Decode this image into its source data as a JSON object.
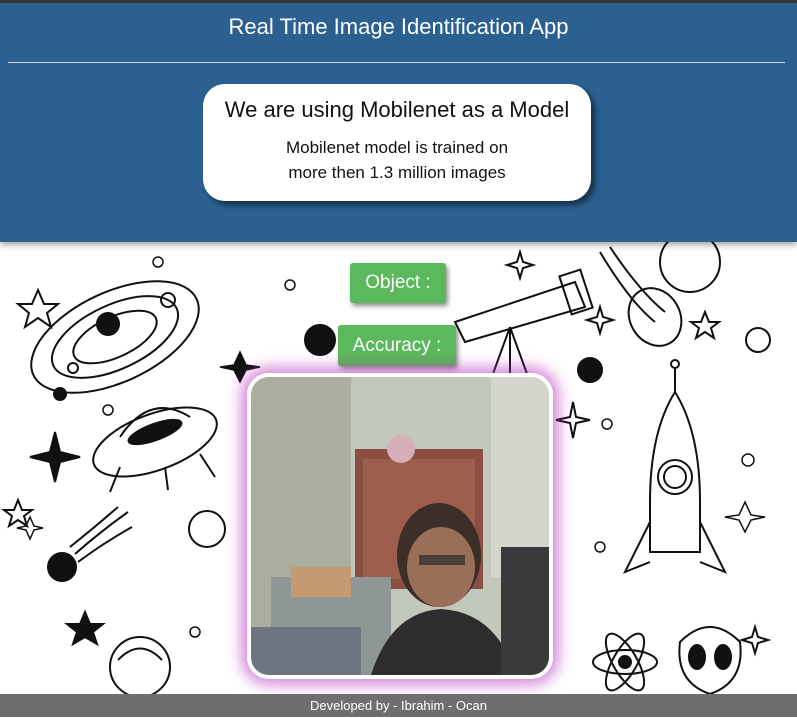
{
  "header": {
    "title": "Real Time Image Identification App"
  },
  "model_card": {
    "heading": "We are using Mobilenet as a Model",
    "line1": "Mobilenet model is trained on",
    "line2": "more then 1.3 million images"
  },
  "results": {
    "object_label": "Object :",
    "accuracy_label": "Accuracy :"
  },
  "footer": {
    "credit": "Developed by - Ibrahim - Ocan"
  },
  "colors": {
    "header_bg": "#2b6090",
    "button_green": "#5cb85c",
    "video_glow": "#b428be",
    "footer_bg": "#6e6e6e"
  },
  "background": {
    "theme": "space-doodles",
    "icons": [
      "star-icon",
      "planet-orbit-icon",
      "ufo-icon",
      "telescope-icon",
      "rocket-icon",
      "comet-icon",
      "sparkle-icon",
      "astronaut-helmet-icon",
      "alien-head-icon",
      "atom-icon",
      "moon-icon"
    ]
  }
}
